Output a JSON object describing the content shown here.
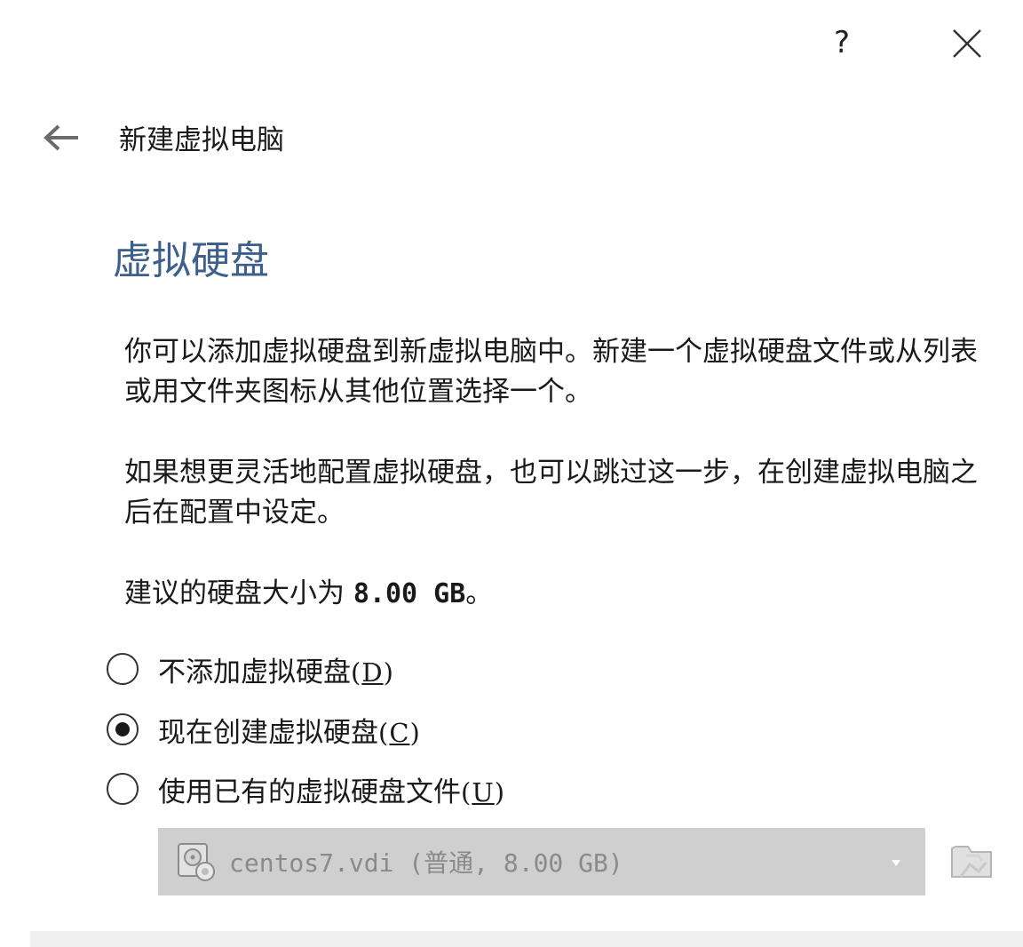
{
  "titlebar": {
    "help_label": "?",
    "close_icon": "close-icon"
  },
  "header": {
    "back_icon": "arrow-left-icon",
    "title": "新建虚拟电脑"
  },
  "main": {
    "heading": "虚拟硬盘",
    "paragraph1": "你可以添加虚拟硬盘到新虚拟电脑中。新建一个虚拟硬盘文件或从列表或用文件夹图标从其他位置选择一个。",
    "paragraph2": "如果想更灵活地配置虚拟硬盘，也可以跳过这一步，在创建虚拟电脑之后在配置中设定。",
    "recommend_prefix": "建议的硬盘大小为 ",
    "recommend_size": "8.00 GB",
    "recommend_suffix": "。",
    "options": [
      {
        "label": "不添加虚拟硬盘",
        "accel_open": "(",
        "accel_key": "D",
        "accel_close": ")",
        "selected": false
      },
      {
        "label": "现在创建虚拟硬盘",
        "accel_open": "(",
        "accel_key": "C",
        "accel_close": ")",
        "selected": true
      },
      {
        "label": "使用已有的虚拟硬盘文件",
        "accel_open": "(",
        "accel_key": "U",
        "accel_close": ")",
        "selected": false
      }
    ],
    "disk_select": {
      "value": "centos7.vdi (普通, 8.00 GB)",
      "disabled": true,
      "icon": "hard-disk-icon"
    },
    "folder_button_icon": "folder-icon"
  },
  "colors": {
    "heading": "#3c5f8c",
    "disabled_bg": "#cfcfcf",
    "disabled_text": "#8a8a8a"
  }
}
